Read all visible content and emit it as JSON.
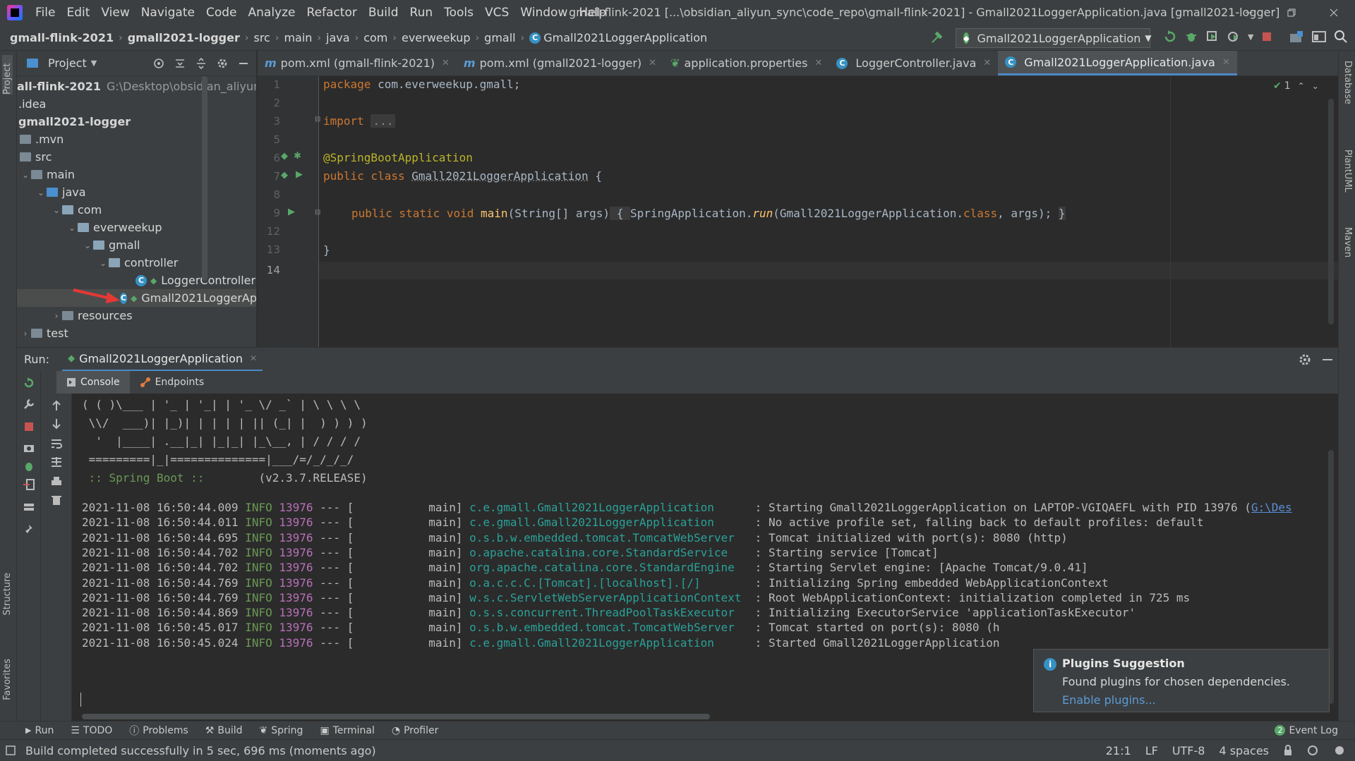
{
  "window": {
    "title": "gmall-flink-2021 [...\\obsidian_aliyun_sync\\code_repo\\gmall-flink-2021] - Gmall2021LoggerApplication.java [gmall2021-logger]",
    "menu": [
      "File",
      "Edit",
      "View",
      "Navigate",
      "Code",
      "Analyze",
      "Refactor",
      "Build",
      "Run",
      "Tools",
      "VCS",
      "Window",
      "Help"
    ]
  },
  "breadcrumb": [
    "gmall-flink-2021",
    "gmall2021-logger",
    "src",
    "main",
    "java",
    "com",
    "everweekup",
    "gmall",
    "Gmall2021LoggerApplication"
  ],
  "run_config": "Gmall2021LoggerApplication",
  "project": {
    "title": "Project",
    "root_label": "all-flink-2021",
    "root_path": "G:\\Desktop\\obsidian_aliyun_sy",
    "nodes": [
      ".idea",
      "gmall2021-logger",
      ".mvn",
      "src",
      "main",
      "java",
      "com",
      "everweekup",
      "gmall",
      "controller",
      "LoggerController",
      "Gmall2021LoggerAp",
      "resources",
      "test"
    ]
  },
  "tabs": [
    {
      "label": "pom.xml (gmall-flink-2021)",
      "icon": "m"
    },
    {
      "label": "pom.xml (gmall2021-logger)",
      "icon": "m"
    },
    {
      "label": "application.properties",
      "icon": "leaf"
    },
    {
      "label": "LoggerController.java",
      "icon": "c"
    },
    {
      "label": "Gmall2021LoggerApplication.java",
      "icon": "c",
      "active": true
    }
  ],
  "editor": {
    "line_numbers": [
      "1",
      "2",
      "3",
      "5",
      "6",
      "7",
      "8",
      "9",
      "12",
      "13",
      "14"
    ],
    "inspection_count": "1",
    "code": {
      "l1_kw": "package",
      "l1_rest": " com.everweekup.gmall;",
      "l3_kw": "import",
      "l3_fold": "...",
      "l6_ann": "@SpringBootApplication",
      "l7_kw": "public class",
      "l7_name": "Gmall2021LoggerApplication",
      "l7_brace": " {",
      "l9_kw": "public static void",
      "l9_fn": "main",
      "l9_args": "(String[] args)",
      "l9_body_open": " { ",
      "l9_call_cls": "SpringApplication.",
      "l9_call_fn": "run",
      "l9_call_args_a": "(Gmall2021LoggerApplication.",
      "l9_call_class": "class",
      "l9_call_args_b": ", args); ",
      "l9_body_close": "}",
      "l13": "}"
    }
  },
  "run": {
    "label": "Run:",
    "tab": "Gmall2021LoggerApplication",
    "subtabs": [
      "Console",
      "Endpoints"
    ],
    "banner": [
      "( ( )\\___ | '_ | '_| | '_ \\/ _` | \\ \\ \\ \\",
      " \\\\/  ___)| |_)| | | | | || (_| |  ) ) ) )",
      "  '  |____| .__|_| |_|_| |_\\__, | / / / /",
      " =========|_|==============|___/=/_/_/_/"
    ],
    "spring_label": " :: Spring Boot ::",
    "spring_version": "        (v2.3.7.RELEASE)",
    "logs": [
      {
        "ts": "2021-11-08 16:50:44.009",
        "lvl": "INFO",
        "pid": "13976",
        "thread": " --- [           main] ",
        "logger": "c.e.gmall.Gmall2021LoggerApplication     ",
        "msg": " : Starting Gmall2021LoggerApplication on LAPTOP-VGIQAEFL with PID 13976 (",
        "link": "G:\\Des"
      },
      {
        "ts": "2021-11-08 16:50:44.011",
        "lvl": "INFO",
        "pid": "13976",
        "thread": " --- [           main] ",
        "logger": "c.e.gmall.Gmall2021LoggerApplication     ",
        "msg": " : No active profile set, falling back to default profiles: default",
        "link": ""
      },
      {
        "ts": "2021-11-08 16:50:44.695",
        "lvl": "INFO",
        "pid": "13976",
        "thread": " --- [           main] ",
        "logger": "o.s.b.w.embedded.tomcat.TomcatWebServer  ",
        "msg": " : Tomcat initialized with port(s): 8080 (http)",
        "link": ""
      },
      {
        "ts": "2021-11-08 16:50:44.702",
        "lvl": "INFO",
        "pid": "13976",
        "thread": " --- [           main] ",
        "logger": "o.apache.catalina.core.StandardService   ",
        "msg": " : Starting service [Tomcat]",
        "link": ""
      },
      {
        "ts": "2021-11-08 16:50:44.702",
        "lvl": "INFO",
        "pid": "13976",
        "thread": " --- [           main] ",
        "logger": "org.apache.catalina.core.StandardEngine  ",
        "msg": " : Starting Servlet engine: [Apache Tomcat/9.0.41]",
        "link": ""
      },
      {
        "ts": "2021-11-08 16:50:44.769",
        "lvl": "INFO",
        "pid": "13976",
        "thread": " --- [           main] ",
        "logger": "o.a.c.c.C.[Tomcat].[localhost].[/]       ",
        "msg": " : Initializing Spring embedded WebApplicationContext",
        "link": ""
      },
      {
        "ts": "2021-11-08 16:50:44.769",
        "lvl": "INFO",
        "pid": "13976",
        "thread": " --- [           main] ",
        "logger": "w.s.c.ServletWebServerApplicationContext ",
        "msg": " : Root WebApplicationContext: initialization completed in 725 ms",
        "link": ""
      },
      {
        "ts": "2021-11-08 16:50:44.869",
        "lvl": "INFO",
        "pid": "13976",
        "thread": " --- [           main] ",
        "logger": "o.s.s.concurrent.ThreadPoolTaskExecutor  ",
        "msg": " : Initializing ExecutorService 'applicationTaskExecutor'",
        "link": ""
      },
      {
        "ts": "2021-11-08 16:50:45.017",
        "lvl": "INFO",
        "pid": "13976",
        "thread": " --- [           main] ",
        "logger": "o.s.b.w.embedded.tomcat.TomcatWebServer  ",
        "msg": " : Tomcat started on port(s): 8080 (h",
        "link": ""
      },
      {
        "ts": "2021-11-08 16:50:45.024",
        "lvl": "INFO",
        "pid": "13976",
        "thread": " --- [           main] ",
        "logger": "c.e.gmall.Gmall2021LoggerApplication     ",
        "msg": " : Started Gmall2021LoggerApplication",
        "link": ""
      }
    ]
  },
  "popup": {
    "title": "Plugins Suggestion",
    "desc": "Found plugins for chosen dependencies.",
    "action": "Enable plugins..."
  },
  "right_strip": [
    "Database",
    "PlantUML",
    "Maven"
  ],
  "left_strip": [
    "Project",
    "Structure",
    "Favorites"
  ],
  "toolbar": [
    "Run",
    "TODO",
    "Problems",
    "Build",
    "Spring",
    "Terminal",
    "Profiler"
  ],
  "event_log": {
    "count": "2",
    "label": "Event Log"
  },
  "status": {
    "message": "Build completed successfully in 5 sec, 696 ms (moments ago)",
    "position": "21:1",
    "line_sep": "LF",
    "encoding": "UTF-8",
    "indent": "4 spaces"
  },
  "colors": {
    "accent": "#4a88c7",
    "info": "#6a9955",
    "pid": "#b970b9",
    "logger": "#2aa198"
  }
}
